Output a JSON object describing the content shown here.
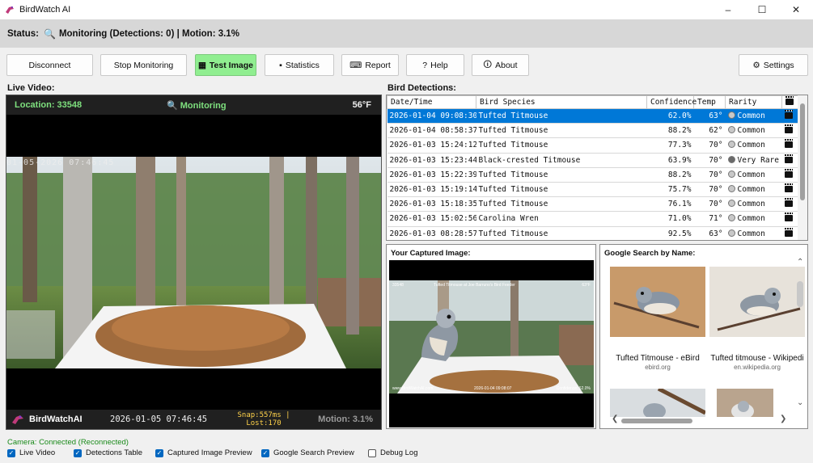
{
  "window": {
    "title": "BirdWatch AI",
    "controls": [
      "–",
      "☐",
      "✕"
    ]
  },
  "status": {
    "text": "Status:",
    "state": "Monitoring (Detections: 0) | Motion: 3.1%"
  },
  "toolbar": {
    "disconnect": "Disconnect",
    "stop_monitoring": "Stop Monitoring",
    "test_image": "Test Image",
    "statistics": "Statistics",
    "report": "Report",
    "help": "Help",
    "about": "About",
    "settings": "Settings"
  },
  "live": {
    "label": "Live Video:",
    "location": "Location: 33548",
    "monitoring": "Monitoring",
    "temperature": "56°F",
    "osd_timestamp": "01-05-2026 07:46:45",
    "brand": "BirdWatchAI",
    "timestamp": "2026-01-05 07:46:45",
    "snap": "Snap:557ms |",
    "lost": "Lost:170",
    "motion": "Motion: 3.1%"
  },
  "detections": {
    "label": "Bird Detections:",
    "columns": [
      "Date/Time",
      "Bird Species",
      "Confidence",
      "Temp",
      "Rarity",
      ""
    ],
    "rows": [
      {
        "datetime": "2026-01-04 09:08:30",
        "species": "Tufted Titmouse",
        "confidence": "62.0%",
        "temp": "63°",
        "rarity": "Common"
      },
      {
        "datetime": "2026-01-04 08:58:37",
        "species": "Tufted Titmouse",
        "confidence": "88.2%",
        "temp": "62°",
        "rarity": "Common"
      },
      {
        "datetime": "2026-01-03 15:24:12",
        "species": "Tufted Titmouse",
        "confidence": "77.3%",
        "temp": "70°",
        "rarity": "Common"
      },
      {
        "datetime": "2026-01-03 15:23:44",
        "species": "Black-crested Titmouse",
        "confidence": "63.9%",
        "temp": "70°",
        "rarity": "Very Rare"
      },
      {
        "datetime": "2026-01-03 15:22:39",
        "species": "Tufted Titmouse",
        "confidence": "88.2%",
        "temp": "70°",
        "rarity": "Common"
      },
      {
        "datetime": "2026-01-03 15:19:14",
        "species": "Tufted Titmouse",
        "confidence": "75.7%",
        "temp": "70°",
        "rarity": "Common"
      },
      {
        "datetime": "2026-01-03 15:18:35",
        "species": "Tufted Titmouse",
        "confidence": "76.1%",
        "temp": "70°",
        "rarity": "Common"
      },
      {
        "datetime": "2026-01-03 15:02:56",
        "species": "Carolina Wren",
        "confidence": "71.0%",
        "temp": "71°",
        "rarity": "Common"
      },
      {
        "datetime": "2026-01-03 08:28:57",
        "species": "Tufted Titmouse",
        "confidence": "92.5%",
        "temp": "63°",
        "rarity": "Common"
      }
    ]
  },
  "captured": {
    "label": "Your Captured Image:",
    "overlay_left": "33548",
    "overlay_title": "Tufted Titmouse at Joe Barruno's Bird Feeder",
    "overlay_temp": "63°F",
    "overlay_site": "www.BirdWatchAI.com",
    "overlay_time": "2026-01-04 09:08:07",
    "overlay_conf": "Confidence: 62.0%"
  },
  "google": {
    "label": "Google Search by Name:",
    "results": [
      {
        "caption": "Tufted Titmouse - eBird",
        "source": "ebird.org"
      },
      {
        "caption": "Tufted titmouse - Wikipedi",
        "source": "en.wikipedia.org"
      }
    ]
  },
  "footer": {
    "camera_status": "Camera: Connected (Reconnected)",
    "checks": [
      {
        "label": "Live Video",
        "checked": true
      },
      {
        "label": "Detections Table",
        "checked": true
      },
      {
        "label": "Captured Image Preview",
        "checked": true
      },
      {
        "label": "Google Search Preview",
        "checked": true
      },
      {
        "label": "Debug Log",
        "checked": false
      }
    ]
  }
}
